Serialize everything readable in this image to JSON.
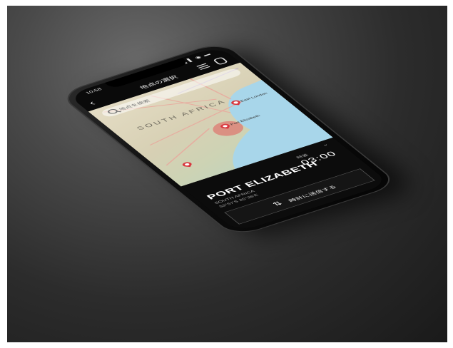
{
  "status_bar": {
    "time": "10:58",
    "icons": "▌▌ ◉ ▬"
  },
  "header": {
    "title": "地点の選択"
  },
  "search": {
    "placeholder": "地点を検索"
  },
  "map": {
    "country_label": "SOUTH AFRICA",
    "city_labels": [
      "Port Elizabeth",
      "East London"
    ]
  },
  "panel": {
    "time_label": "時差",
    "time_value": "03:00",
    "city": "PORT ELIZABETH",
    "country": "SOUTH AFRICA",
    "coordinates": "33°57'S 25°36'E",
    "action_label": "時計に送信する"
  }
}
